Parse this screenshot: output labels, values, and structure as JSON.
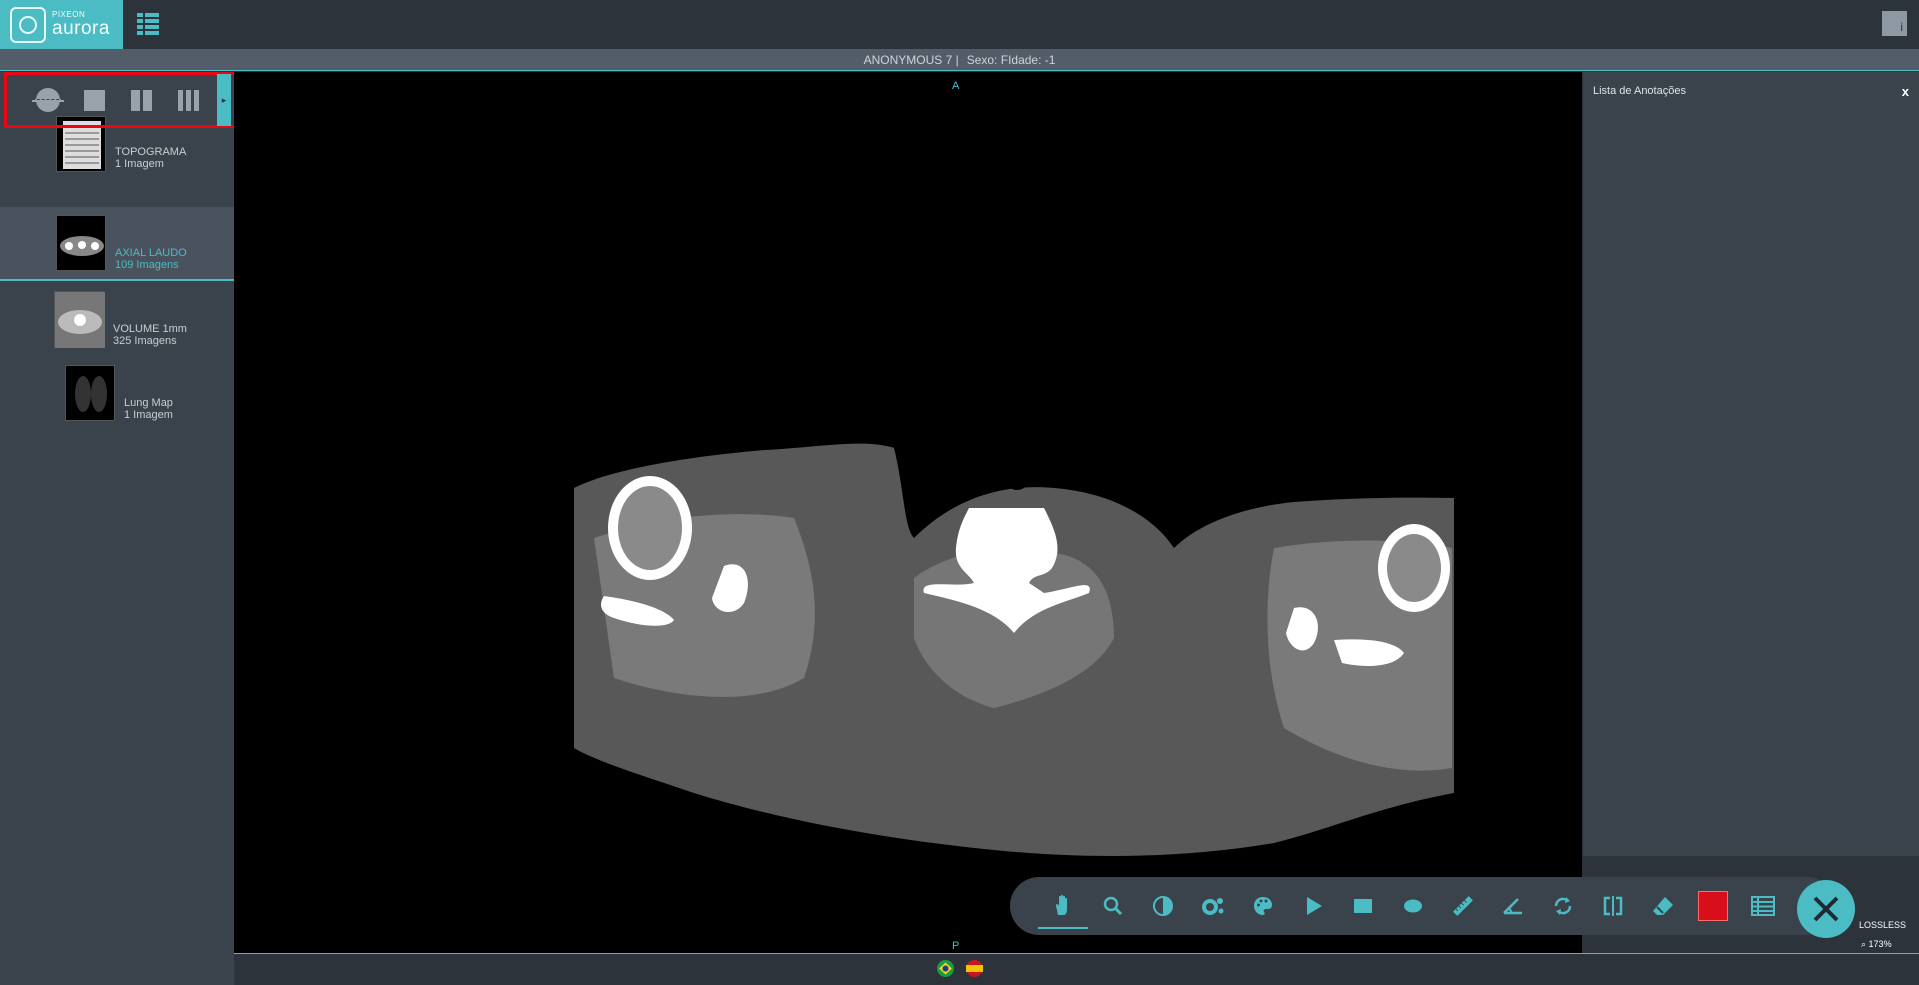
{
  "app": {
    "logo_small": "PIXEON",
    "logo_big": "aurora"
  },
  "patient": {
    "name": "ANONYMOUS 7 |",
    "sex": "Sexo: F",
    "age": "Idade: -1"
  },
  "series": [
    {
      "name": "TOPOGRAMA",
      "count": "1 Imagem"
    },
    {
      "name": "AXIAL LAUDO",
      "count": "109 Imagens"
    },
    {
      "name": "VOLUME 1mm",
      "count": "325 Imagens"
    },
    {
      "name": "Lung Map",
      "count": "1 Imagem"
    }
  ],
  "viewer": {
    "orient_top": "A",
    "orient_bottom": "P",
    "compression": "LOSSLESS",
    "zoom": "173%"
  },
  "annotations": {
    "title": "Lista de Anotações",
    "close": "x"
  },
  "info_button": "i",
  "colors": {
    "accent": "#4bbcc4",
    "highlight": "#f00313",
    "annotation_color": "#d80f1b"
  },
  "toolbar": [
    "hand-icon",
    "magnifier-icon",
    "contrast-icon",
    "window-level-icon",
    "palette-icon",
    "play-icon",
    "rectangle-icon",
    "ellipse-icon",
    "ruler-icon",
    "angle-icon",
    "rotate-icon",
    "flip-icon",
    "eraser-icon",
    "color-picker",
    "list-icon"
  ],
  "languages": [
    "pt-BR",
    "es"
  ]
}
